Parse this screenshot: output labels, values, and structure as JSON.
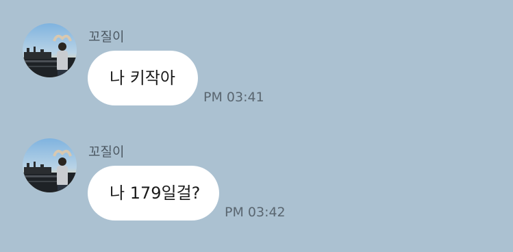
{
  "messages": [
    {
      "sender": "꼬질이",
      "text": "나 키작아",
      "time": "PM 03:41",
      "avatar_icon": "profile-photo-person-heart-pose"
    },
    {
      "sender": "꼬질이",
      "text": "나 179일걸?",
      "time": "PM 03:42",
      "avatar_icon": "profile-photo-person-heart-pose"
    }
  ],
  "colors": {
    "background": "#abc1d1",
    "bubble": "#ffffff",
    "sender_text": "#4c5862",
    "time_text": "#5a6670"
  }
}
